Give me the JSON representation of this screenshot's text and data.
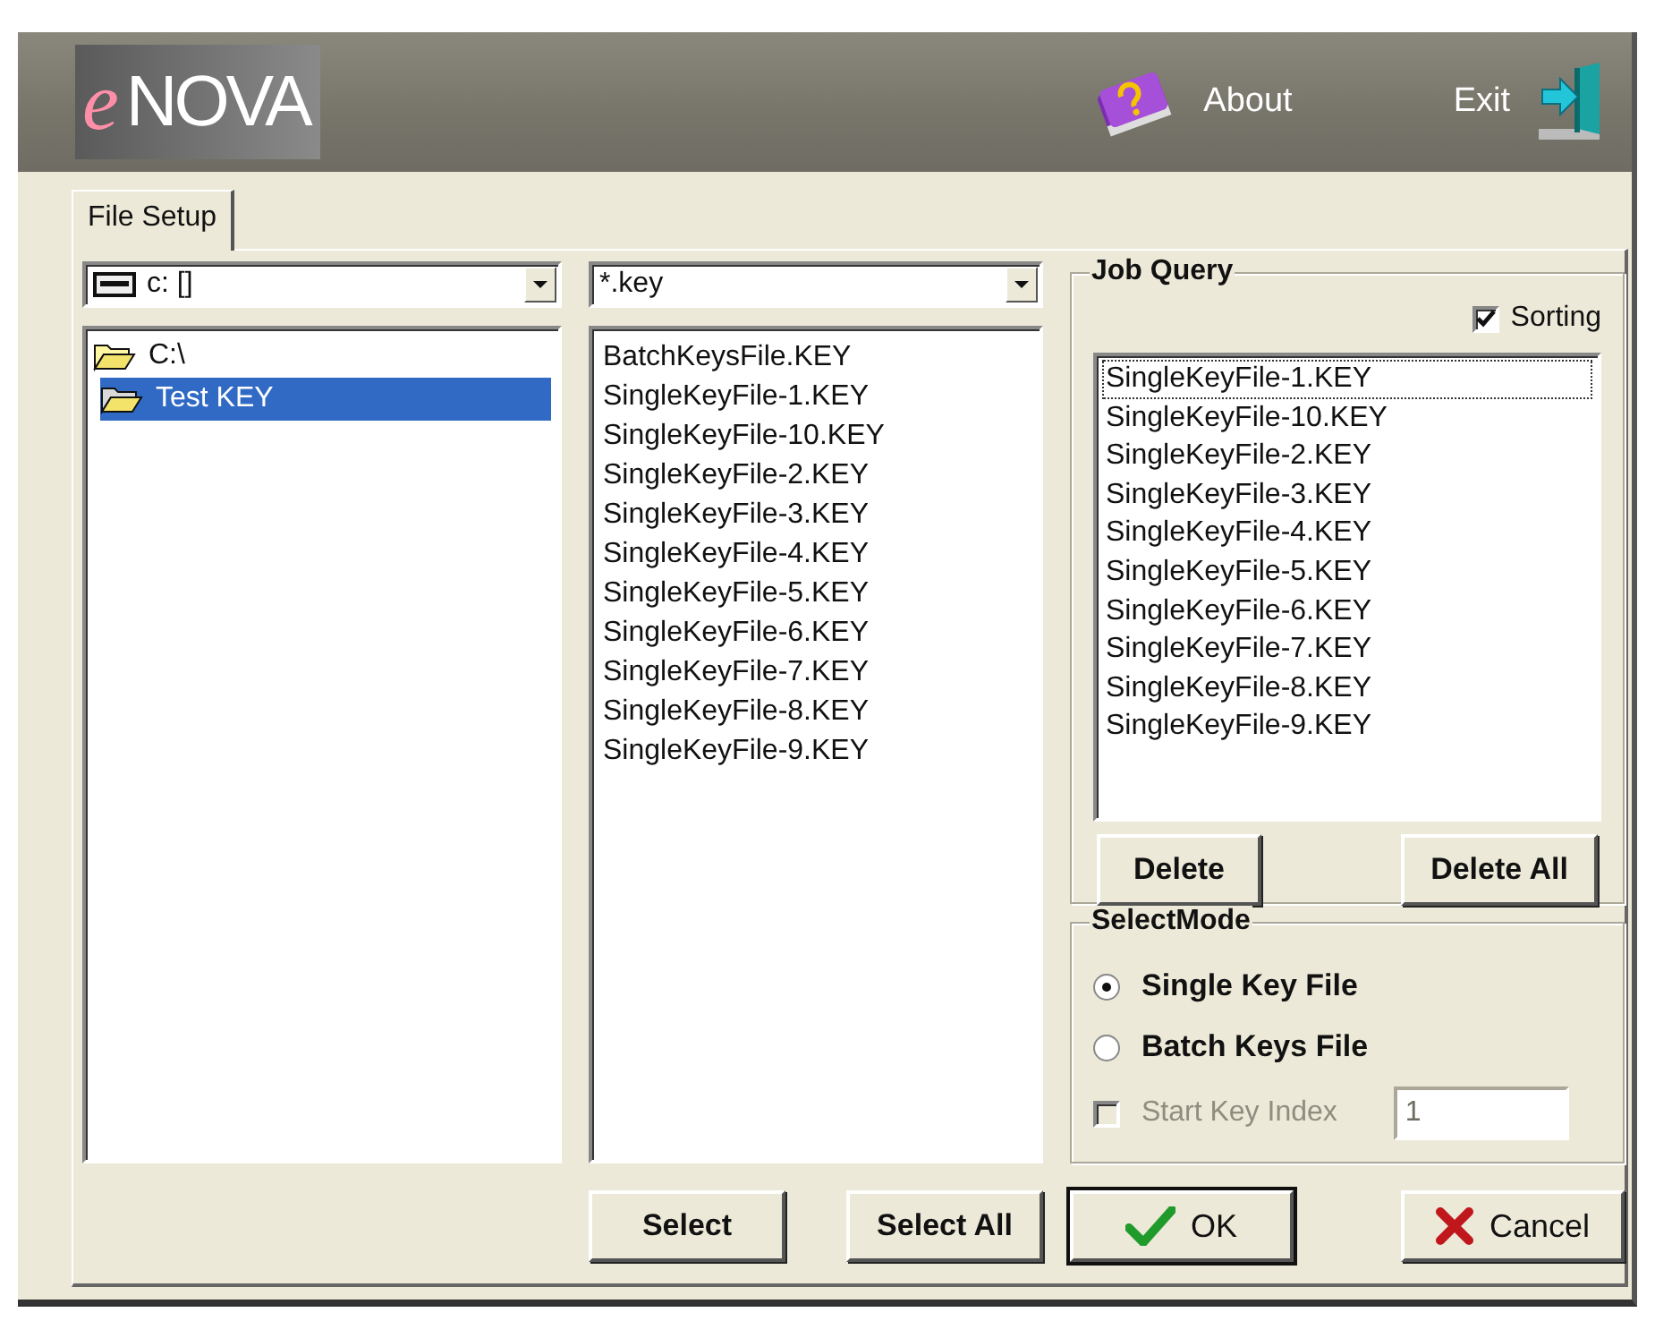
{
  "header": {
    "logo_accent": "e",
    "logo_rest": "NOVA",
    "about": "About",
    "exit": "Exit"
  },
  "tabs": [
    {
      "label": "File Setup",
      "selected": true
    }
  ],
  "drive_combo": {
    "value": "c: []"
  },
  "folder_tree": [
    {
      "label": "C:\\",
      "selected": false,
      "children": [
        {
          "label": "Test KEY",
          "selected": true
        }
      ]
    }
  ],
  "filter_combo": {
    "value": "*.key"
  },
  "files": [
    {
      "label": "BatchKeysFile.KEY",
      "selected": false
    },
    {
      "label": "SingleKeyFile-1.KEY",
      "selected": false
    },
    {
      "label": "SingleKeyFile-10.KEY",
      "selected": false
    },
    {
      "label": "SingleKeyFile-2.KEY",
      "selected": false
    },
    {
      "label": "SingleKeyFile-3.KEY",
      "selected": false
    },
    {
      "label": "SingleKeyFile-4.KEY",
      "selected": false
    },
    {
      "label": "SingleKeyFile-5.KEY",
      "selected": false
    },
    {
      "label": "SingleKeyFile-6.KEY",
      "selected": false
    },
    {
      "label": "SingleKeyFile-7.KEY",
      "selected": false
    },
    {
      "label": "SingleKeyFile-8.KEY",
      "selected": false
    },
    {
      "label": "SingleKeyFile-9.KEY",
      "selected": false
    }
  ],
  "job_query": {
    "title": "Job Query",
    "sorting": {
      "label": "Sorting",
      "checked": true
    },
    "items": [
      {
        "label": "SingleKeyFile-1.KEY",
        "focused": true
      },
      {
        "label": "SingleKeyFile-10.KEY",
        "focused": false
      },
      {
        "label": "SingleKeyFile-2.KEY",
        "focused": false
      },
      {
        "label": "SingleKeyFile-3.KEY",
        "focused": false
      },
      {
        "label": "SingleKeyFile-4.KEY",
        "focused": false
      },
      {
        "label": "SingleKeyFile-5.KEY",
        "focused": false
      },
      {
        "label": "SingleKeyFile-6.KEY",
        "focused": false
      },
      {
        "label": "SingleKeyFile-7.KEY",
        "focused": false
      },
      {
        "label": "SingleKeyFile-8.KEY",
        "focused": false
      },
      {
        "label": "SingleKeyFile-9.KEY",
        "focused": false
      }
    ],
    "buttons": [
      "Delete",
      "Delete All"
    ]
  },
  "select_mode": {
    "title": "SelectMode",
    "options": [
      {
        "label": "Single Key File",
        "selected": true
      },
      {
        "label": "Batch Keys File",
        "selected": false
      }
    ],
    "start_key_index": {
      "label": "Start Key Index",
      "checked": false,
      "disabled": true,
      "value": "1"
    }
  },
  "file_buttons": [
    "Select",
    "Select All"
  ],
  "dialog_buttons": [
    {
      "label": "OK",
      "kind": "ok"
    },
    {
      "label": "Cancel",
      "kind": "cancel"
    }
  ]
}
